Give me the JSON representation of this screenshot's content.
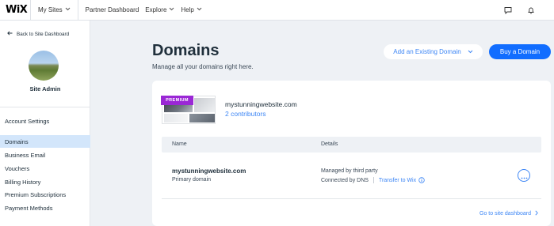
{
  "topbar": {
    "logo": "WiX",
    "my_sites": "My Sites",
    "nav": [
      "Partner Dashboard",
      "Explore",
      "Help"
    ],
    "icons": [
      "chat-icon",
      "bell-icon"
    ]
  },
  "sidebar": {
    "back": "Back to Site Dashboard",
    "site_role": "Site Admin",
    "items": [
      {
        "label": "Account Settings",
        "active": false
      },
      {
        "label": "Domains",
        "active": true
      },
      {
        "label": "Business Email",
        "active": false
      },
      {
        "label": "Vouchers",
        "active": false
      },
      {
        "label": "Billing History",
        "active": false
      },
      {
        "label": "Premium Subscriptions",
        "active": false
      },
      {
        "label": "Payment Methods",
        "active": false
      }
    ]
  },
  "main": {
    "title": "Domains",
    "subtitle": "Manage all your domains right here.",
    "add_existing_label": "Add an Existing Domain",
    "buy_label": "Buy a Domain",
    "site": {
      "badge": "PREMIUM",
      "name": "mystunningwebsite.com",
      "contributors": "2 contributors"
    },
    "table": {
      "headers": [
        "Name",
        "Details"
      ],
      "rows": [
        {
          "domain": "mystunningwebsite.com",
          "type": "Primary domain",
          "managed": "Managed by third party",
          "connection": "Connected by DNS",
          "transfer": "Transfer to Wix"
        }
      ]
    },
    "goto_dashboard": "Go to site dashboard"
  },
  "colors": {
    "accent": "#116dff",
    "link": "#3d86f5",
    "premium": "#9a27d5",
    "active_nav": "#d3e6fb",
    "background": "#eef1f5"
  }
}
